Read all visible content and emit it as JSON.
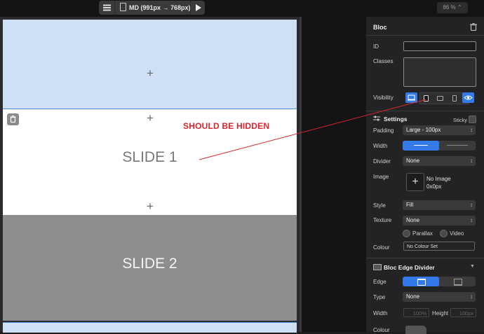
{
  "toolbar": {
    "menu_icon": "hamburger-icon",
    "device_label": "MD (991px → 768px)",
    "zoom_label": "86 %"
  },
  "canvas": {
    "slide1": "SLIDE 1",
    "slide2": "SLIDE 2",
    "annotation": "SHOULD BE HIDDEN",
    "annotation_color": "#d7262c"
  },
  "inspector": {
    "title": "Bloc",
    "id_label": "ID",
    "id_value": "",
    "classes_label": "Classes",
    "visibility_label": "Visibility",
    "settings_title": "Settings",
    "sticky_label": "Sticky",
    "padding_label": "Padding",
    "padding_value": "Large - 100px",
    "width_label": "Width",
    "divider_label": "Divider",
    "divider_value": "None",
    "image_label": "Image",
    "image_name": "No Image",
    "image_size": "0x0px",
    "style_label": "Style",
    "style_value": "Fill",
    "texture_label": "Texture",
    "texture_value": "None",
    "parallax_label": "Parallax",
    "video_label": "Video",
    "colour_label": "Colour",
    "colour_value": "No Colour Set",
    "edge_divider_title": "Bloc Edge Divider",
    "edge_label": "Edge",
    "type_label": "Type",
    "type_value": "None",
    "ed_width_label": "Width",
    "ed_width_value": "100%",
    "ed_height_label": "Height",
    "ed_height_value": "100px",
    "ed_colour_label": "Colour",
    "accent_color": "#3479e8"
  }
}
